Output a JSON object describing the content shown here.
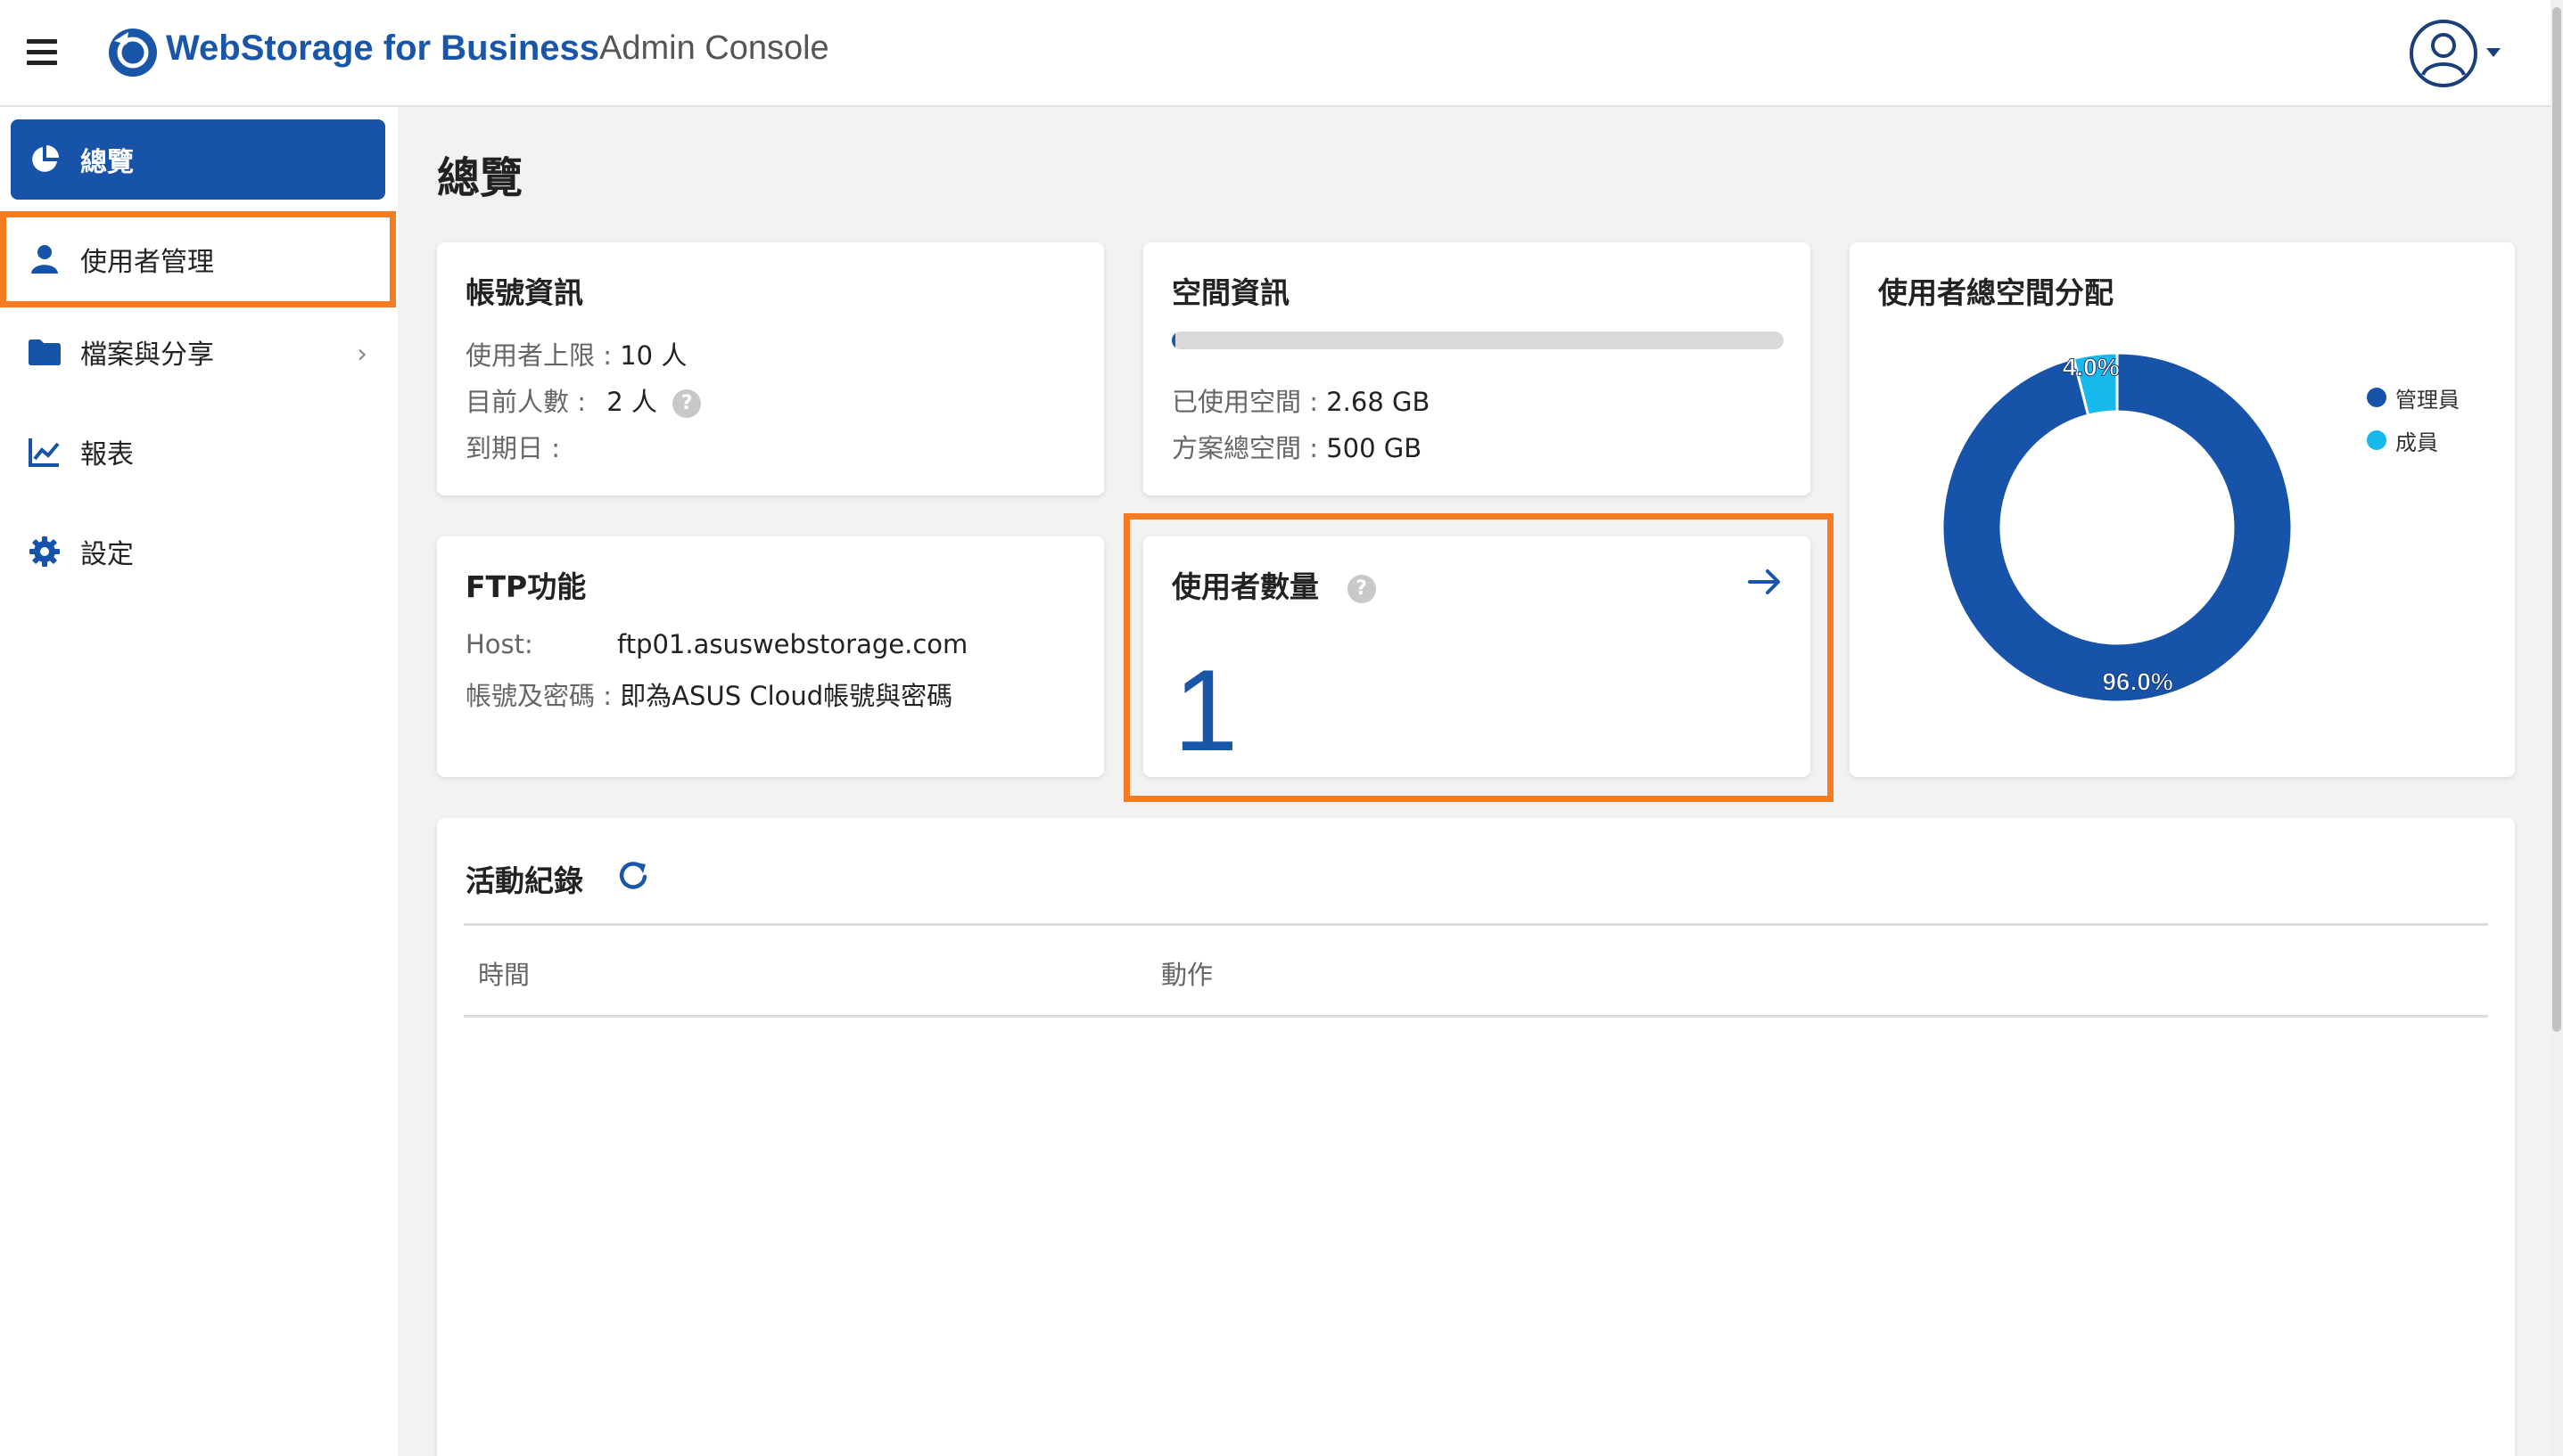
{
  "header": {
    "brand": "WebStorage for Business",
    "subtitle": "Admin Console",
    "menu_icon": "hamburger-icon",
    "logo_icon": "webstorage-logo-icon",
    "user_icon": "user-avatar-icon"
  },
  "sidebar": {
    "items": [
      {
        "label": "總覽",
        "icon": "pie-chart-icon",
        "active": true
      },
      {
        "label": "使用者管理",
        "icon": "user-icon",
        "highlighted": true
      },
      {
        "label": "檔案與分享",
        "icon": "folder-icon",
        "has_submenu": true
      },
      {
        "label": "報表",
        "icon": "line-chart-icon"
      },
      {
        "label": "設定",
        "icon": "gear-icon"
      }
    ],
    "chevron": "›"
  },
  "page_title": "總覽",
  "account_info": {
    "title": "帳號資訊",
    "user_limit_label": "使用者上限 : ",
    "user_limit_value": "10 人",
    "current_users_label": "目前人數 : ",
    "current_users_value": "2 人",
    "expiry_label": "到期日 :",
    "expiry_value": ""
  },
  "space_info": {
    "title": "空間資訊",
    "used_label": "已使用空間 : ",
    "used_value": "2.68 GB",
    "total_label": "方案總空間 : ",
    "total_value": "500 GB",
    "usage_fraction": 0.00536
  },
  "ftp": {
    "title": "FTP功能",
    "host_label": "Host:",
    "host_value": "ftp01.asuswebstorage.com",
    "cred_label": "帳號及密碼 : ",
    "cred_value": "即為ASUS Cloud帳號與密碼"
  },
  "user_count": {
    "title": "使用者數量",
    "value": "1",
    "help": "?",
    "arrow_icon": "arrow-right-icon"
  },
  "space_allocation": {
    "title": "使用者總空間分配",
    "slice_labels": [
      "96.0%",
      "4.0%"
    ]
  },
  "chart_data": {
    "type": "pie",
    "title": "使用者總空間分配",
    "categories": [
      "管理員",
      "成員"
    ],
    "values": [
      96.0,
      4.0
    ],
    "colors": [
      "#1753a9",
      "#17b8ec"
    ],
    "donut": true,
    "legend": "right"
  },
  "activity": {
    "title": "活動紀錄",
    "refresh_icon": "refresh-icon",
    "columns": [
      "時間",
      "動作"
    ],
    "rows": []
  },
  "colors": {
    "primary": "#1753a9",
    "highlight": "#f47b20",
    "accent": "#17b8ec"
  }
}
